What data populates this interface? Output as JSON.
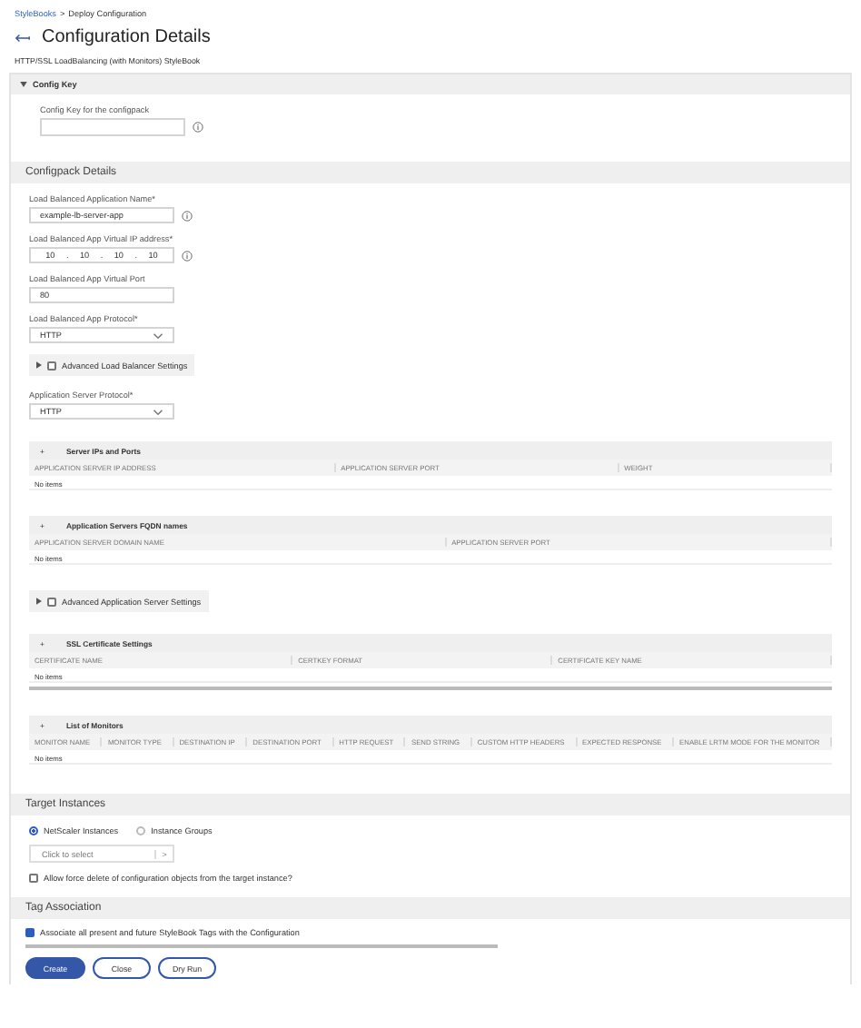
{
  "breadcrumb": {
    "link": "StyleBooks",
    "separator": ">",
    "current": "Deploy Configuration"
  },
  "title": "Configuration Details",
  "subtitle": "HTTP/SSL LoadBalancing (with Monitors) StyleBook",
  "config_key": {
    "header": "Config Key",
    "expanded": true,
    "field": {
      "label": "Config Key for the configpack",
      "info": true
    }
  },
  "configpack": {
    "header": "Configpack Details",
    "items": [
      {
        "kind": "text",
        "label": "Load Balanced Application Name*",
        "value": "example-lb-server-app",
        "info": true
      },
      {
        "kind": "ip",
        "label": "Load Balanced App Virtual IP address*",
        "octets": [
          "10",
          "10",
          "10",
          "10"
        ],
        "separator": ".",
        "info": true
      },
      {
        "kind": "text",
        "label": "Load Balanced App Virtual Port",
        "value": "80"
      },
      {
        "kind": "select",
        "label": "Load Balanced App Protocol*",
        "value": "HTTP"
      },
      {
        "kind": "toggle",
        "label": "Advanced Load Balancer Settings",
        "checked": false
      },
      {
        "kind": "select",
        "label": "Application Server Protocol*",
        "value": "HTTP"
      },
      {
        "kind": "table",
        "expander": "+",
        "title": "Server IPs and Ports",
        "columns": [
          "APPLICATION SERVER IP ADDRESS",
          "APPLICATION SERVER PORT",
          "WEIGHT"
        ],
        "empty": "No items"
      },
      {
        "kind": "table",
        "expander": "+",
        "title": "Application Servers FQDN names",
        "columns": [
          "APPLICATION SERVER DOMAIN NAME",
          "APPLICATION SERVER PORT"
        ],
        "empty": "No items"
      },
      {
        "kind": "toggle",
        "label": "Advanced Application Server Settings",
        "checked": false
      },
      {
        "kind": "table",
        "expander": "+",
        "title": "SSL Certificate Settings",
        "columns": [
          "CERTIFICATE NAME",
          "CERTKEY FORMAT",
          "CERTIFICATE KEY NAME"
        ],
        "empty": "No items",
        "scrollbar": true
      },
      {
        "kind": "table",
        "expander": "+",
        "title": "List of Monitors",
        "columns": [
          "MONITOR NAME",
          "MONITOR TYPE",
          "DESTINATION IP",
          "DESTINATION PORT",
          "HTTP REQUEST",
          "SEND STRING",
          "CUSTOM HTTP HEADERS",
          "EXPECTED RESPONSE",
          "ENABLE LRTM MODE FOR THE MONITOR"
        ],
        "empty": "No items"
      }
    ]
  },
  "target": {
    "header": "Target Instances",
    "radios": [
      {
        "label": "NetScaler Instances",
        "selected": true
      },
      {
        "label": "Instance Groups",
        "selected": false
      }
    ],
    "picker": {
      "placeholder": "Click to select",
      "arrow": ">"
    },
    "checkbox": {
      "label": "Allow force delete of configuration objects from the target instance?",
      "checked": false
    }
  },
  "tag": {
    "header": "Tag Association",
    "checkbox": {
      "label": "Associate all present and future StyleBook Tags with the Configuration",
      "checked": true
    }
  },
  "buttons": [
    {
      "label": "Create",
      "primary": true
    },
    {
      "label": "Close",
      "primary": false
    },
    {
      "label": "Dry Run",
      "primary": false
    }
  ]
}
